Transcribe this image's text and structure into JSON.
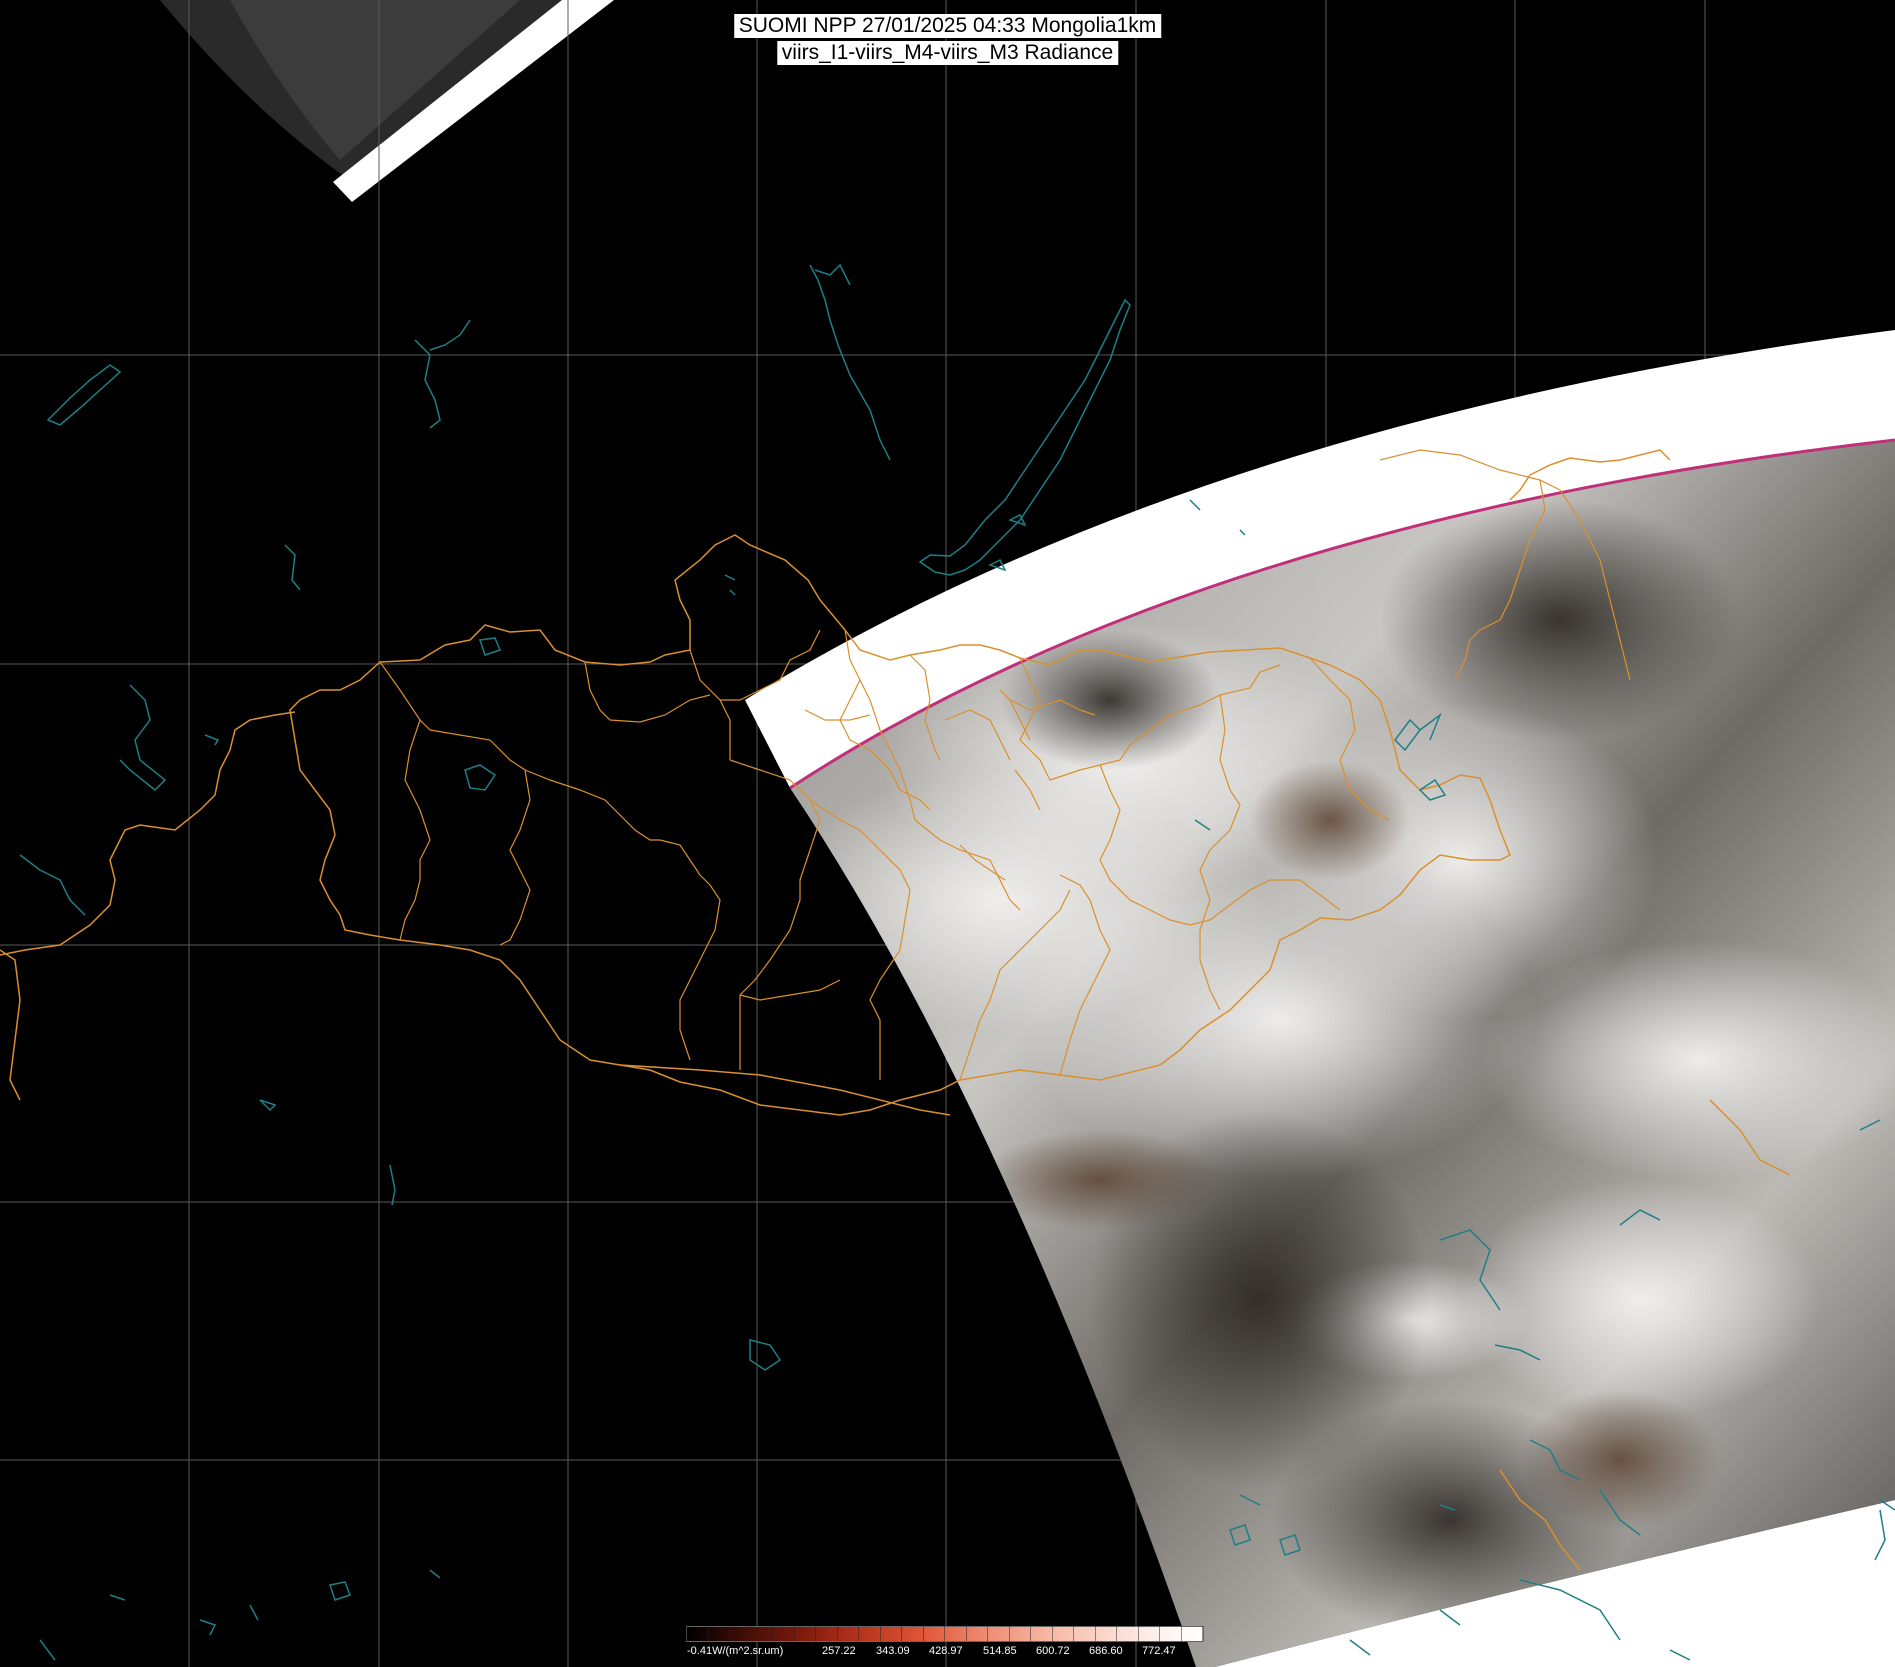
{
  "title": {
    "line1": "SUOMI NPP 27/01/2025 04:33 Mongolia1km",
    "line2": "viirs_I1-viirs_M4-viirs_M3 Radiance"
  },
  "colors": {
    "background": "#000000",
    "graticule": "#5a5a5a",
    "borders": "#d9902e",
    "coastlines": "#1e7f86",
    "swath_edge": "#ffffff",
    "swath_rim": "#c0307a"
  },
  "legend": {
    "unit_label": "-0.41W/(m^2.sr.um)",
    "ticks": [
      "257.22",
      "343.09",
      "428.97",
      "514.85",
      "600.72",
      "686.60",
      "772.47"
    ]
  },
  "layers": [
    "graticule",
    "country-borders",
    "province-borders",
    "coastlines-lakes",
    "satellite-swath"
  ]
}
